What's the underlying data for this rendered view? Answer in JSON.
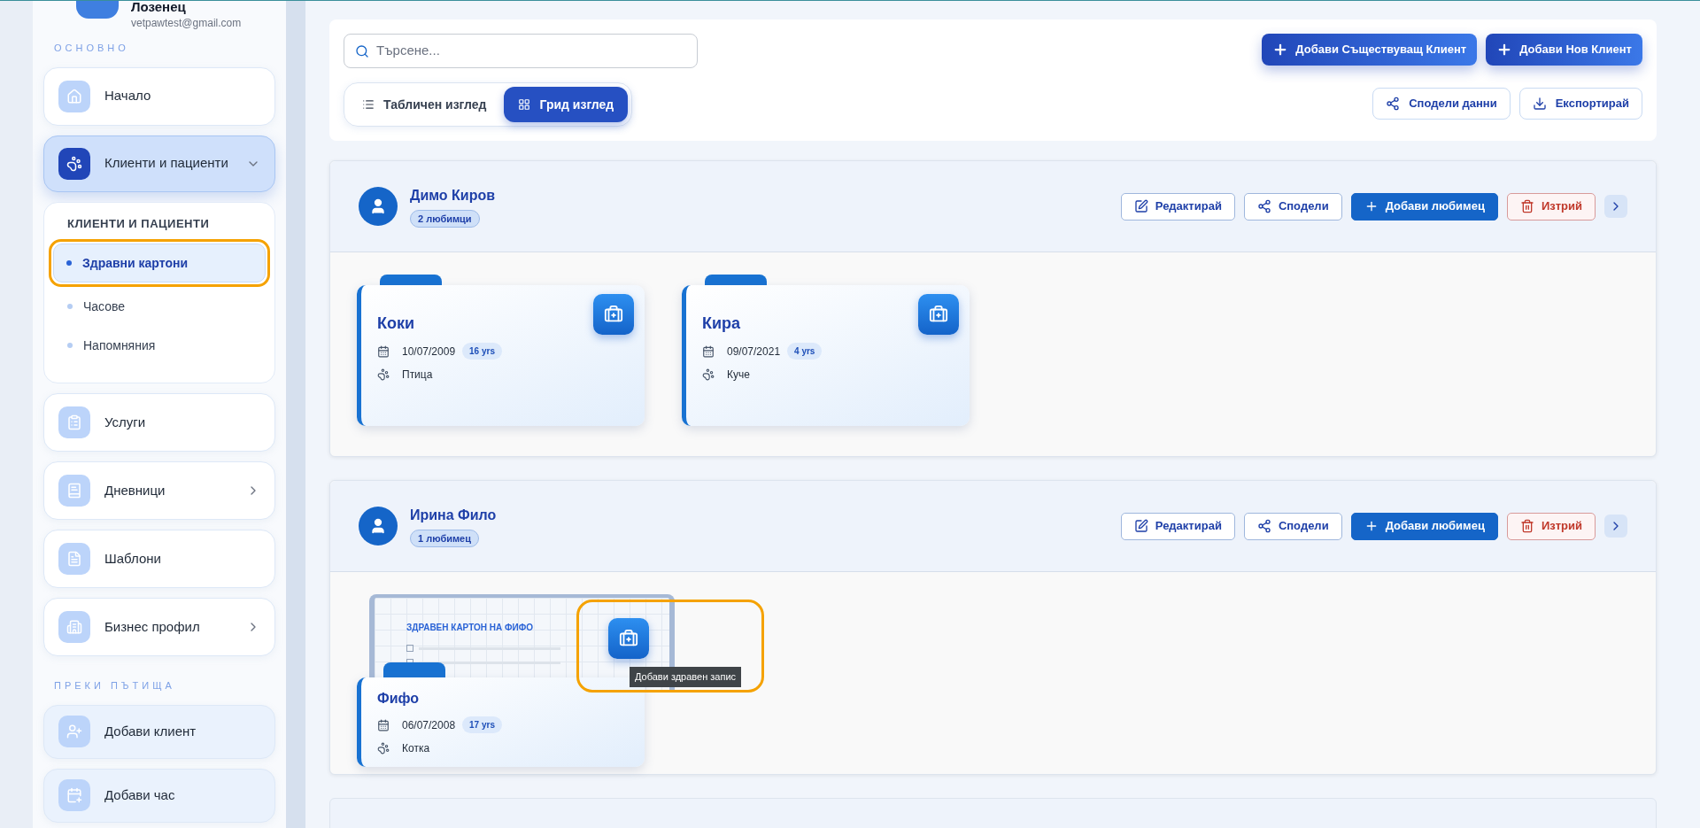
{
  "sidebar": {
    "user": {
      "name": "Лозенец",
      "email": "vetpawtest@gmail.com"
    },
    "sections": [
      {
        "title": "ОСНОВНО",
        "kind": "main",
        "items": [
          {
            "label": "Начало",
            "selected": false,
            "expandable": false
          },
          {
            "label": "Клиенти и пациенти",
            "selected": true,
            "expandable": true,
            "expanded": true,
            "submenu": {
              "title": "КЛИЕНТИ И ПАЦИЕНТИ",
              "items": [
                {
                  "label": "Здравни картони",
                  "selected": true,
                  "annotated": true
                },
                {
                  "label": "Часове",
                  "selected": false,
                  "annotated": false
                },
                {
                  "label": "Напомняния",
                  "selected": false,
                  "annotated": false
                }
              ]
            }
          },
          {
            "label": "Услуги",
            "selected": false,
            "expandable": false
          },
          {
            "label": "Дневници",
            "selected": false,
            "expandable": true,
            "expanded": false
          },
          {
            "label": "Шаблони",
            "selected": false,
            "expandable": false
          },
          {
            "label": "Бизнес профил",
            "selected": false,
            "expandable": true,
            "expanded": false
          }
        ]
      },
      {
        "title": "ПРЕКИ ПЪТИЩА",
        "kind": "shortcuts",
        "items": [
          {
            "label": "Добави клиент",
            "selected": false,
            "expandable": false
          },
          {
            "label": "Добави час",
            "selected": false,
            "expandable": false
          }
        ]
      }
    ]
  },
  "toolbar": {
    "search": {
      "placeholder": "Търсене..."
    },
    "primary_buttons": [
      "Добави Съществуващ Клиент",
      "Добави Нов Клиент"
    ],
    "views": [
      {
        "label": "Табличен изглед",
        "selected": false
      },
      {
        "label": "Грид изглед",
        "selected": true
      }
    ],
    "secondary_buttons": [
      {
        "label": "Сподели данни",
        "kind": "share"
      },
      {
        "label": "Експортирай",
        "kind": "export"
      }
    ]
  },
  "clients": [
    {
      "partial": false,
      "name": "Димо Киров",
      "pet_count": "2 любимци",
      "actions": [
        {
          "label": "Редактирай",
          "kind": "edit"
        },
        {
          "label": "Сподели",
          "kind": "share"
        },
        {
          "label": "Добави любимец",
          "kind": "add"
        },
        {
          "label": "Изтрий",
          "kind": "delete"
        }
      ],
      "pets": [
        {
          "name": "Коки",
          "birth_date": "10/07/2009",
          "age": "16 yrs",
          "species": "Птица",
          "hovered": false,
          "annotated": false
        },
        {
          "name": "Кира",
          "birth_date": "09/07/2021",
          "age": "4 yrs",
          "species": "Куче",
          "hovered": false,
          "annotated": false
        }
      ]
    },
    {
      "partial": false,
      "name": "Ирина Фило",
      "pet_count": "1 любимец",
      "actions": [
        {
          "label": "Редактирай",
          "kind": "edit"
        },
        {
          "label": "Сподели",
          "kind": "share"
        },
        {
          "label": "Добави любимец",
          "kind": "add"
        },
        {
          "label": "Изтрий",
          "kind": "delete"
        }
      ],
      "pets": [
        {
          "name": "Фифо",
          "birth_date": "06/07/2008",
          "age": "17 yrs",
          "species": "Котка",
          "hovered": true,
          "annotated": true,
          "preview_title": "ЗДРАВЕН КАРТОН НА ФИФО",
          "tooltip": "Добави здравен запис"
        }
      ]
    },
    {
      "partial": true
    }
  ]
}
